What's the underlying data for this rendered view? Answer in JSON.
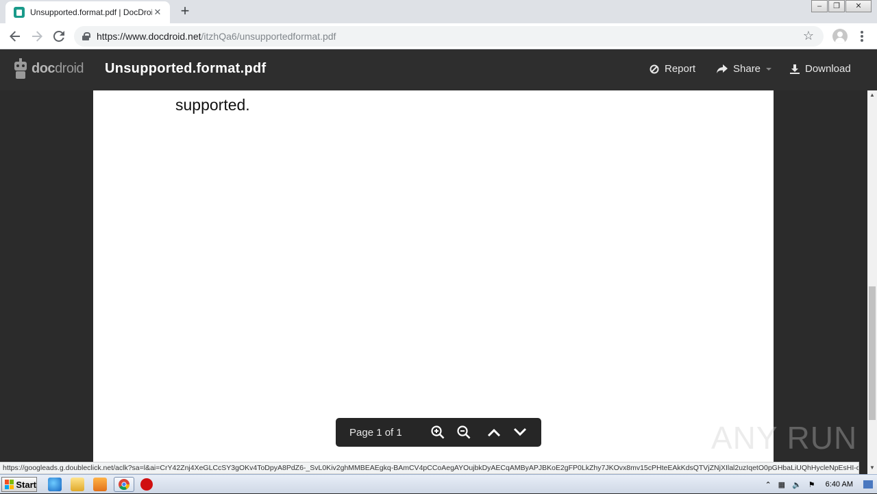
{
  "browser": {
    "tab_title": "Unsupported.format.pdf | DocDroid",
    "tab_close": "✕",
    "new_tab": "+",
    "url_host": "https://www.docdroid.net",
    "url_path": "/itzhQa6/unsupportedformat.pdf",
    "window_controls": [
      "–",
      "❐",
      "✕"
    ]
  },
  "app": {
    "logo_bold": "doc",
    "logo_rest": "droid",
    "doc_title": "Unsupported.format.pdf",
    "actions": {
      "report": "Report",
      "share": "Share",
      "download": "Download"
    }
  },
  "document": {
    "visible_text": "supported."
  },
  "pager": {
    "label": "Page 1 of 1"
  },
  "watermark": "ANY RUN",
  "status_url": "https://googleads.g.doubleclick.net/aclk?sa=l&ai=CrY42Znj4XeGLCcSY3gOKv4ToDpyA8PdZ6-_SvL0Kiv2ghMMBEAEgkq-BAmCV4pCCoAegAYOujbkDyAECqAMByAPJBKoE2gFP0LkZhy7JKOvx8mv15cPHteEAkKdsQTVjZNjXIlal2uzIqetO0pGHbaLiUQhHycleNpEsHI-cB...",
  "taskbar": {
    "start_label": "Start",
    "clock": "6:40 AM"
  },
  "colors": {
    "header_bg": "#2e2e2e",
    "doc_bg": "#2b2b2b",
    "favicon": "#1a9a8a"
  }
}
